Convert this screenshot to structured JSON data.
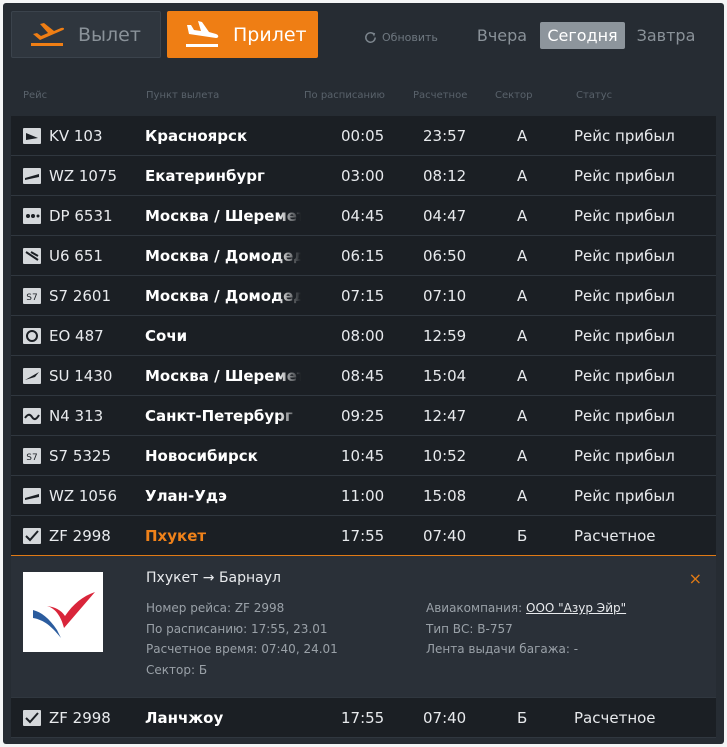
{
  "tabs": {
    "departure": "Вылет",
    "arrival": "Прилет"
  },
  "refresh_label": "Обновить",
  "days": {
    "yesterday": "Вчера",
    "today": "Сегодня",
    "tomorrow": "Завтра"
  },
  "headers": {
    "flight": "Рейс",
    "origin": "Пункт вылета",
    "scheduled": "По расписанию",
    "estimated": "Расчетное",
    "sector": "Сектор",
    "status": "Статус"
  },
  "rows": [
    {
      "flight": "KV 103",
      "city": "Красноярск",
      "scheduled": "00:05",
      "estimated": "23:57",
      "sector": "А",
      "status": "Рейс прибыл"
    },
    {
      "flight": "WZ 1075",
      "city": "Екатеринбург",
      "scheduled": "03:00",
      "estimated": "08:12",
      "sector": "А",
      "status": "Рейс прибыл"
    },
    {
      "flight": "DP 6531",
      "city": "Москва / Шереметьево",
      "scheduled": "04:45",
      "estimated": "04:47",
      "sector": "А",
      "status": "Рейс прибыл"
    },
    {
      "flight": "U6 651",
      "city": "Москва / Домодедово",
      "scheduled": "06:15",
      "estimated": "06:50",
      "sector": "А",
      "status": "Рейс прибыл"
    },
    {
      "flight": "S7 2601",
      "city": "Москва / Домодедово",
      "scheduled": "07:15",
      "estimated": "07:10",
      "sector": "А",
      "status": "Рейс прибыл"
    },
    {
      "flight": "EO 487",
      "city": "Сочи",
      "scheduled": "08:00",
      "estimated": "12:59",
      "sector": "А",
      "status": "Рейс прибыл"
    },
    {
      "flight": "SU 1430",
      "city": "Москва / Шереметьево",
      "scheduled": "08:45",
      "estimated": "15:04",
      "sector": "А",
      "status": "Рейс прибыл"
    },
    {
      "flight": "N4 313",
      "city": "Санкт-Петербург",
      "scheduled": "09:25",
      "estimated": "12:47",
      "sector": "А",
      "status": "Рейс прибыл"
    },
    {
      "flight": "S7 5325",
      "city": "Новосибирск",
      "scheduled": "10:45",
      "estimated": "10:52",
      "sector": "А",
      "status": "Рейс прибыл"
    },
    {
      "flight": "WZ 1056",
      "city": "Улан-Удэ",
      "scheduled": "11:00",
      "estimated": "15:08",
      "sector": "А",
      "status": "Рейс прибыл"
    },
    {
      "flight": "ZF 2998",
      "city": "Пхукет",
      "scheduled": "17:55",
      "estimated": "07:40",
      "sector": "Б",
      "status": "Расчетное"
    }
  ],
  "detail": {
    "route": "Пхукет → Барнаул",
    "flight_number": "Номер рейса: ZF 2998",
    "scheduled": "По расписанию: 17:55, 23.01",
    "estimated": "Расчетное время: 07:40, 24.01",
    "sector": "Сектор: Б",
    "airline_label": "Авиакомпания:",
    "airline_name": "ООО \"Азур Эйр\"",
    "aircraft": "Тип ВС: B-757",
    "baggage": "Лента выдачи багажа: -",
    "close_symbol": "×"
  },
  "last_row": {
    "flight": "ZF 2998",
    "city": "Ланчжоу",
    "scheduled": "17:55",
    "estimated": "07:40",
    "sector": "Б",
    "status": "Расчетное"
  },
  "colors": {
    "accent": "#ef7e14",
    "board_bg": "#262c33",
    "row_bg": "#1b1f24"
  },
  "icons": {
    "departure": "plane-takeoff-icon",
    "arrival": "plane-landing-icon",
    "refresh": "refresh-icon",
    "airline_logo": "airline-logo-icon"
  }
}
